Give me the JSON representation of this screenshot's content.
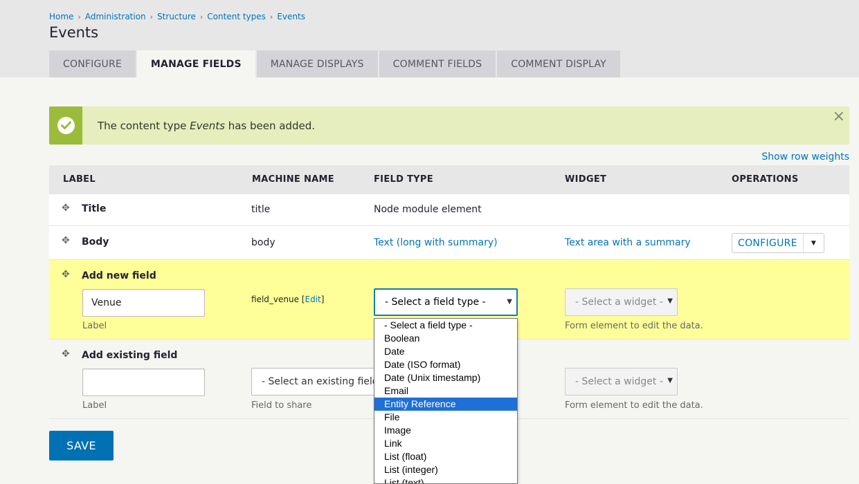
{
  "breadcrumb": [
    "Home",
    "Administration",
    "Structure",
    "Content types",
    "Events"
  ],
  "page_title": "Events",
  "tabs": [
    "CONFIGURE",
    "MANAGE FIELDS",
    "MANAGE DISPLAYS",
    "COMMENT FIELDS",
    "COMMENT DISPLAY"
  ],
  "active_tab": "MANAGE FIELDS",
  "message": {
    "prefix": "The content type ",
    "name": "Events",
    "suffix": " has been added.",
    "close": "×"
  },
  "show_row_weights": "Show row weights",
  "table": {
    "headers": {
      "label": "LABEL",
      "machine_name": "MACHINE NAME",
      "field_type": "FIELD TYPE",
      "widget": "WIDGET",
      "operations": "OPERATIONS"
    },
    "rows": [
      {
        "label": "Title",
        "machine_name": "title",
        "field_type": "Node module element"
      },
      {
        "label": "Body",
        "machine_name": "body",
        "field_type": "Text (long with summary)",
        "widget": "Text area with a summary",
        "operation": "CONFIGURE"
      }
    ],
    "add_new": {
      "title": "Add new field",
      "label_value": "Venue",
      "label_help": "Label",
      "machine_name": "field_venue",
      "edit_link": "Edit",
      "field_type_select": "- Select a field type -",
      "widget_select": "- Select a widget -",
      "widget_help": "Form element to edit the data."
    },
    "add_existing": {
      "title": "Add existing field",
      "label_value": "",
      "label_help": "Label",
      "existing_select": "- Select an existing field -",
      "existing_help": "Field to share",
      "widget_select": "- Select a widget -",
      "widget_help": "Form element to edit the data."
    }
  },
  "save_button": "SAVE",
  "field_type_options": [
    "- Select a field type -",
    "Boolean",
    "Date",
    "Date (ISO format)",
    "Date (Unix timestamp)",
    "Email",
    "Entity Reference",
    "File",
    "Image",
    "Link",
    "List (float)",
    "List (integer)",
    "List (text)"
  ],
  "highlighted_option": "Entity Reference",
  "colors": {
    "link": "#0074bd",
    "status_bg": "#e5eebc",
    "status_icon": "#9bbc3a",
    "add_row": "#ffff99",
    "save": "#0071b3",
    "highlight": "#1e6fd6"
  }
}
